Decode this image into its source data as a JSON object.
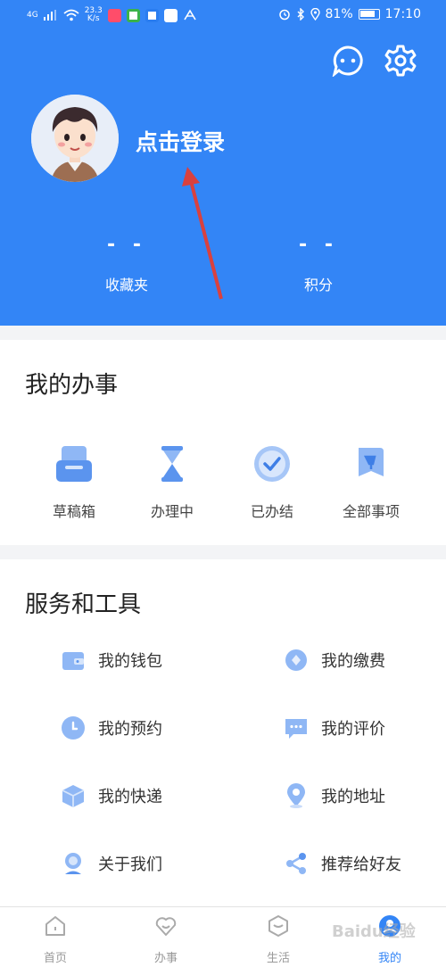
{
  "status_bar": {
    "signal": "4G",
    "speed": "23.3",
    "speed_unit": "K/s",
    "battery": "81%",
    "time": "17:10"
  },
  "header": {
    "login_text": "点击登录",
    "stats": [
      {
        "value": "- -",
        "label": "收藏夹"
      },
      {
        "value": "- -",
        "label": "积分"
      }
    ]
  },
  "my_tasks": {
    "title": "我的办事",
    "items": [
      {
        "label": "草稿箱",
        "icon": "drafts-icon"
      },
      {
        "label": "办理中",
        "icon": "hourglass-icon"
      },
      {
        "label": "已办结",
        "icon": "check-icon"
      },
      {
        "label": "全部事项",
        "icon": "bookmark-icon"
      }
    ]
  },
  "tools": {
    "title": "服务和工具",
    "items": [
      {
        "label": "我的钱包",
        "icon": "wallet-icon"
      },
      {
        "label": "我的缴费",
        "icon": "payment-icon"
      },
      {
        "label": "我的预约",
        "icon": "clock-icon"
      },
      {
        "label": "我的评价",
        "icon": "comment-icon"
      },
      {
        "label": "我的快递",
        "icon": "package-icon"
      },
      {
        "label": "我的地址",
        "icon": "location-icon"
      },
      {
        "label": "关于我们",
        "icon": "user-icon"
      },
      {
        "label": "推荐给好友",
        "icon": "share-icon"
      }
    ]
  },
  "bottom_nav": {
    "items": [
      {
        "label": "首页",
        "icon": "home-icon"
      },
      {
        "label": "办事",
        "icon": "heart-icon"
      },
      {
        "label": "生活",
        "icon": "hexagon-icon"
      },
      {
        "label": "我的",
        "icon": "profile-icon"
      }
    ],
    "active": 3
  },
  "watermark": "Baidu经验",
  "colors": {
    "primary": "#3385f6",
    "icon_blue": "#8fb7f5",
    "background": "#f3f4f6"
  }
}
